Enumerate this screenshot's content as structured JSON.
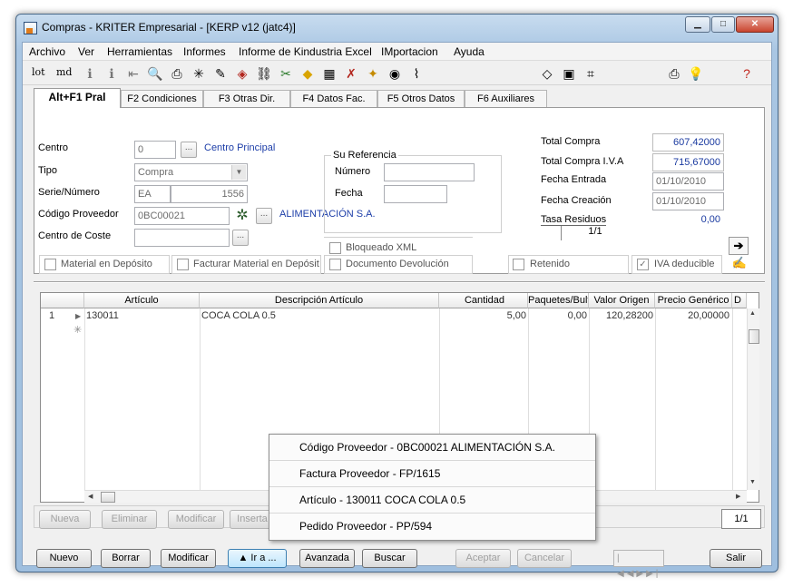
{
  "window": {
    "title": "Compras - KRITER Empresarial - [KERP v12 (jatc4)]",
    "minimize": "▁",
    "maximize": "□",
    "close": "✕"
  },
  "menu": [
    "Archivo",
    "Ver",
    "Herramientas",
    "Informes",
    "Informe de Kindustria Excel",
    "IMportacion",
    "Ayuda"
  ],
  "toolbar": {
    "t1": "lot",
    "t2": "md"
  },
  "tabs": [
    "Alt+F1 Pral",
    "F2 Condiciones",
    "F3 Otras Dir.",
    "F4 Datos Fac.",
    "F5 Otros Datos",
    "F6 Auxiliares"
  ],
  "form": {
    "centro_label": "Centro",
    "centro_value": "0",
    "centro_link": "Centro Principal",
    "tipo_label": "Tipo",
    "tipo_value": "Compra",
    "serie_label": "Serie/Número",
    "serie_value": "EA",
    "numero_value": "1556",
    "proveedor_label": "Código Proveedor",
    "proveedor_value": "0BC00021",
    "proveedor_link": "ALIMENTACIÓN S.A.",
    "coste_label": "Centro de Coste",
    "coste_value": "",
    "su_ref_title": "Su Referencia",
    "su_numero_label": "Número",
    "su_numero_value": "",
    "su_fecha_label": "Fecha",
    "su_fecha_value": "",
    "total_compra_label": "Total Compra",
    "total_compra_value": "607,42000",
    "total_iva_label": "Total Compra I.V.A",
    "total_iva_value": "715,67000",
    "fecha_entrada_label": "Fecha Entrada",
    "fecha_entrada_value": "01/10/2010",
    "fecha_creacion_label": "Fecha Creación",
    "fecha_creacion_value": "01/10/2010",
    "tasa_label": "Tasa Residuos",
    "tasa_value": "0,00",
    "tasa_page": "1/1",
    "chk_material": "Material en Depósito",
    "chk_facturar": "Facturar Material en Depósit",
    "chk_bloqueado": "Bloqueado XML",
    "chk_devolucion": "Documento Devolución",
    "chk_retenido": "Retenido",
    "chk_iva": "IVA deducible"
  },
  "grid": {
    "headers": [
      "Artículo",
      "Descripción Artículo",
      "Cantidad",
      "Paquetes/Bult",
      "Valor Origen",
      "Precio Genérico",
      "D"
    ],
    "rows": [
      {
        "num": "1",
        "articulo": "130011",
        "descripcion": "COCA COLA 0.5",
        "cantidad": "5,00",
        "paquetes": "0,00",
        "valor": "120,28200",
        "precio": "20,00000"
      }
    ],
    "new_row_marker": "✳"
  },
  "grid_buttons": {
    "nueva": "Nueva",
    "eliminar": "Eliminar",
    "modificar": "Modificar",
    "insertar": "Inserta"
  },
  "grid_page": "1/1",
  "bottom_buttons": {
    "nuevo": "Nuevo",
    "borrar": "Borrar",
    "modificar": "Modificar",
    "ira": "▲ Ir a ...",
    "avanzada": "Avanzada",
    "buscar": "Buscar",
    "aceptar": "Aceptar",
    "cancelar": "Cancelar",
    "salir": "Salir"
  },
  "popup": [
    "Código Proveedor - 0BC00021 ALIMENTACIÓN S.A.",
    "Factura Proveedor - FP/1615",
    "Artículo - 130011 COCA COLA 0.5",
    "Pedido Proveedor - PP/594"
  ]
}
